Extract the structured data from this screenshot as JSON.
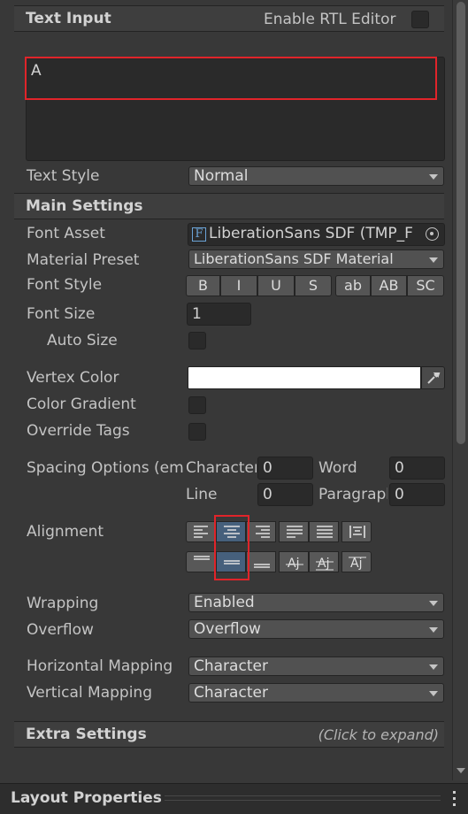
{
  "text_input": {
    "header": "Text Input",
    "rtl_label": "Enable RTL Editor",
    "value": "A"
  },
  "text_style": {
    "label": "Text Style",
    "value": "Normal"
  },
  "main_settings": {
    "header": "Main Settings",
    "font_asset": {
      "label": "Font Asset",
      "value": "LiberationSans SDF (TMP_F"
    },
    "material_preset": {
      "label": "Material Preset",
      "value": "LiberationSans SDF Material"
    },
    "font_style": {
      "label": "Font Style",
      "buttons": [
        "B",
        "I",
        "U",
        "S",
        "ab",
        "AB",
        "SC"
      ]
    },
    "font_size": {
      "label": "Font Size",
      "value": "1"
    },
    "auto_size": {
      "label": "Auto Size"
    },
    "vertex_color": {
      "label": "Vertex Color",
      "color": "#ffffff"
    },
    "color_gradient": {
      "label": "Color Gradient"
    },
    "override_tags": {
      "label": "Override Tags"
    },
    "spacing": {
      "label": "Spacing Options (em)",
      "character_label": "Character",
      "character_value": "0",
      "word_label": "Word",
      "word_value": "0",
      "line_label": "Line",
      "line_value": "0",
      "paragraph_label": "Paragraph",
      "paragraph_value": "0"
    },
    "alignment": {
      "label": "Alignment"
    },
    "wrapping": {
      "label": "Wrapping",
      "value": "Enabled"
    },
    "overflow": {
      "label": "Overflow",
      "value": "Overflow"
    },
    "horizontal_mapping": {
      "label": "Horizontal Mapping",
      "value": "Character"
    },
    "vertical_mapping": {
      "label": "Vertical Mapping",
      "value": "Character"
    }
  },
  "extra_settings": {
    "header": "Extra Settings",
    "hint": "(Click to expand)"
  },
  "layout_properties": {
    "header": "Layout Properties"
  },
  "colors": {
    "highlight": "#e0242a",
    "active_button": "#46607c",
    "background": "#383838"
  }
}
